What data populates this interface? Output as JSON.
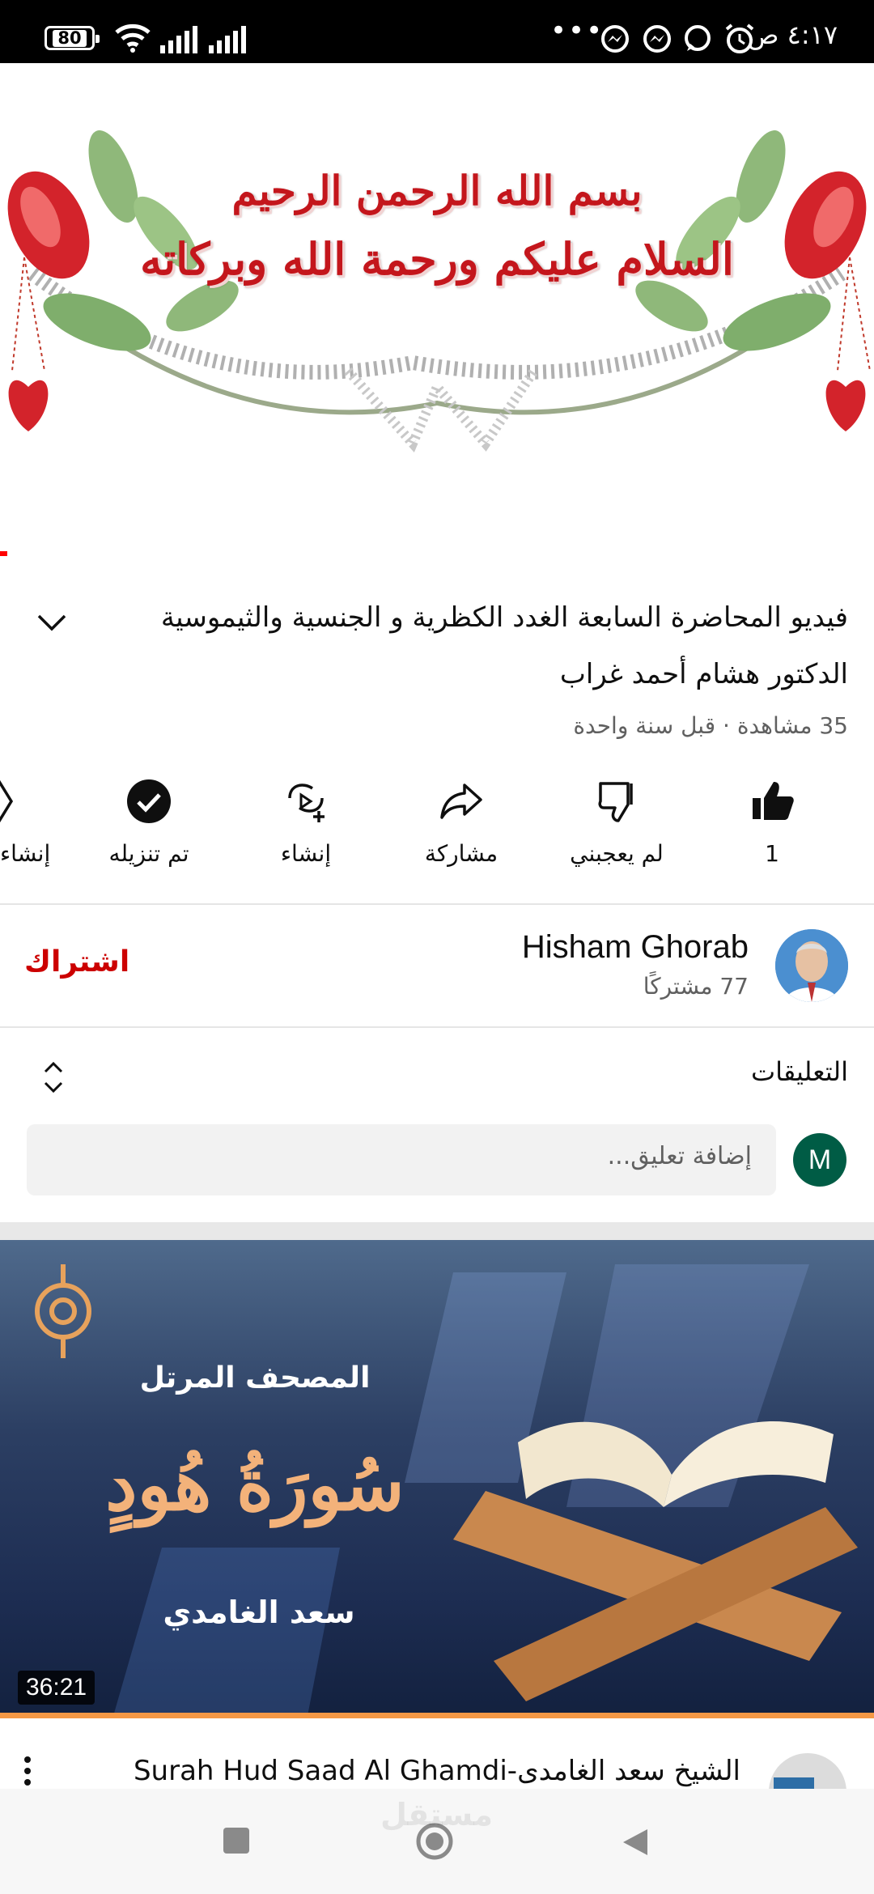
{
  "status_bar": {
    "battery": "80",
    "time": "٤:١٧ ص"
  },
  "banner": {
    "line1": "بسم الله الرحمن الرحيم",
    "line2": "السلام عليكم ورحمة الله وبركاته"
  },
  "video": {
    "title": "فيديو المحاضرة السابعة الغدد الكظرية و الجنسية والثيموسية الدكتور هشام أحمد غراب",
    "meta": "35 مشاهدة · قبل سنة واحدة"
  },
  "actions": {
    "like_count": "1",
    "dislike": "لم يعجبني",
    "share": "مشاركة",
    "create": "إنشاء",
    "downloaded": "تم تنزيله",
    "create_partial": "إنشاء"
  },
  "channel": {
    "name": "Hisham Ghorab",
    "subscribers": "77 مشتركًا",
    "subscribe": "اشتراك"
  },
  "comments": {
    "title": "التعليقات",
    "avatar_letter": "M",
    "placeholder": "إضافة تعليق..."
  },
  "next_video": {
    "thumb_top": "المصحف المرتل",
    "thumb_main": "سُورَةُ هُودٍ",
    "thumb_bottom": "سعد الغامدي",
    "duration": "36:21",
    "title": "الشيخ سعد الغامدى-Surah Hud Saad Al Ghamdi"
  },
  "watermark": "مستقل",
  "colors": {
    "accent_red": "#cc0000",
    "progress_orange": "#f59845",
    "comment_avatar": "#005c45"
  }
}
